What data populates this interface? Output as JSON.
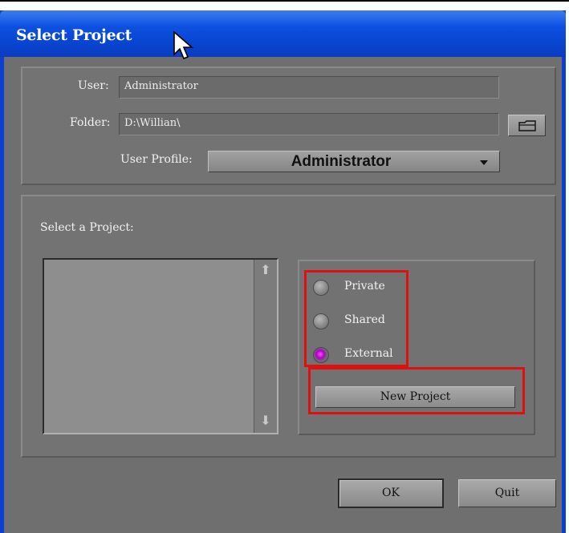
{
  "dialog": {
    "title": "Select Project"
  },
  "user": {
    "label": "User:",
    "value": "Administrator"
  },
  "folder": {
    "label": "Folder:",
    "value": "D:\\Willian\\"
  },
  "user_profile": {
    "label": "User Profile:",
    "selected": "Administrator"
  },
  "project_list": {
    "label": "Select a Project:",
    "items": []
  },
  "project_type": {
    "options": [
      {
        "label": "Private",
        "selected": false
      },
      {
        "label": "Shared",
        "selected": false
      },
      {
        "label": "External",
        "selected": true
      }
    ]
  },
  "buttons": {
    "new_project": "New Project",
    "ok": "OK",
    "quit": "Quit"
  },
  "icons": {
    "folder_browse": "folder-icon",
    "scroll_up": "arrow-up-icon",
    "scroll_down": "arrow-down-icon",
    "cursor": "mouse-pointer-icon"
  },
  "colors": {
    "titlebar": "#0a3fd0",
    "highlight_box": "#e01010",
    "selected_radio": "#c000d8"
  }
}
